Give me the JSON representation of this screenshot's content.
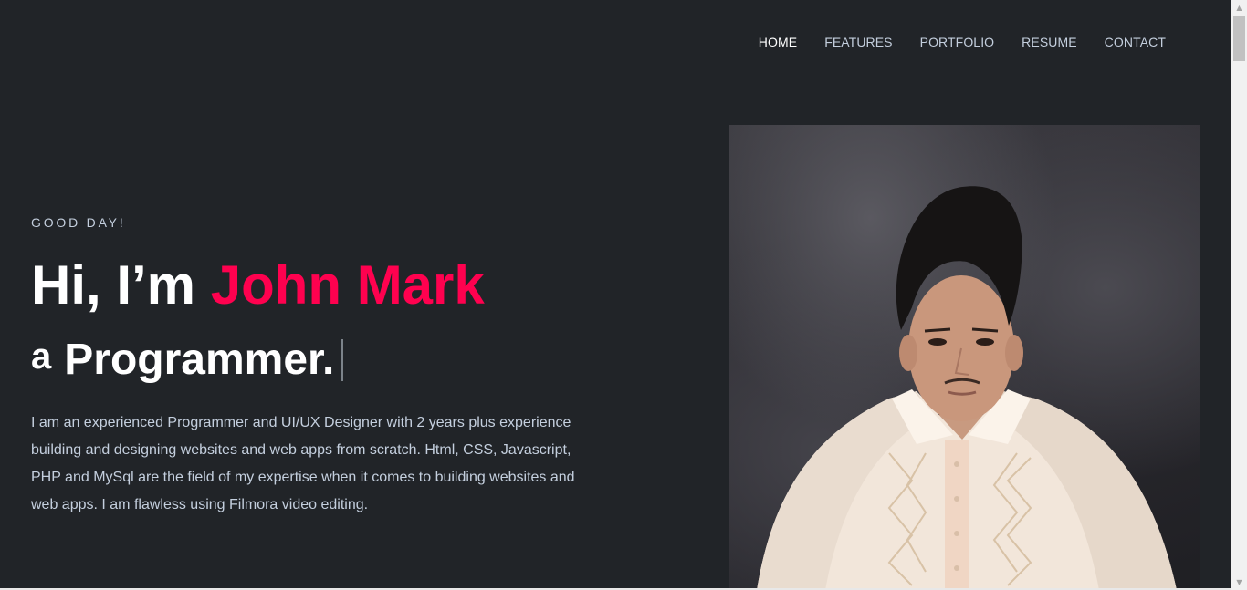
{
  "nav": {
    "items": [
      {
        "label": "HOME",
        "active": true
      },
      {
        "label": "FEATURES",
        "active": false
      },
      {
        "label": "PORTFOLIO",
        "active": false
      },
      {
        "label": "RESUME",
        "active": false
      },
      {
        "label": "CONTACT",
        "active": false
      }
    ]
  },
  "hero": {
    "greeting": "GOOD DAY!",
    "headline_prefix": "Hi, I’m ",
    "name": "John Mark",
    "role_prefix": "a",
    "role": "Programmer.",
    "description": "I am an experienced Programmer and UI/UX Designer with 2 years plus experience building and designing websites and web apps from scratch. Html, CSS, Javascript, PHP and MySql are the field of my expertise when it comes to building websites and web apps. I am flawless using Filmora video editing."
  },
  "colors": {
    "background": "#212428",
    "accent": "#ff014f",
    "text": "#c4cfde"
  },
  "icons": {
    "scroll_up": "scroll-up-arrow-icon",
    "scroll_down": "scroll-down-arrow-icon"
  }
}
